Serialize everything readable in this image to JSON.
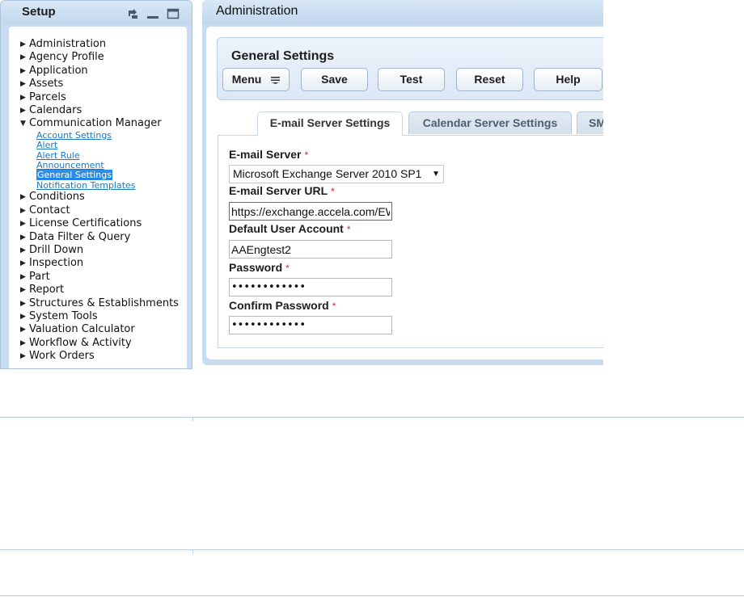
{
  "setup": {
    "title": "Setup",
    "tree": [
      {
        "label": "Administration",
        "expanded": false
      },
      {
        "label": "Agency Profile",
        "expanded": false
      },
      {
        "label": "Application",
        "expanded": false
      },
      {
        "label": "Assets",
        "expanded": false
      },
      {
        "label": "Parcels",
        "expanded": false
      },
      {
        "label": "Calendars",
        "expanded": false
      },
      {
        "label": "Communication Manager",
        "expanded": true,
        "children": [
          {
            "label": "Account Settings"
          },
          {
            "label": "Alert"
          },
          {
            "label": "Alert Rule"
          },
          {
            "label": "Announcement"
          },
          {
            "label": "General Settings",
            "selected": true
          },
          {
            "label": "Notification Templates"
          }
        ]
      },
      {
        "label": "Conditions",
        "expanded": false
      },
      {
        "label": "Contact",
        "expanded": false
      },
      {
        "label": "License Certifications",
        "expanded": false
      },
      {
        "label": "Data Filter & Query",
        "expanded": false
      },
      {
        "label": "Drill Down",
        "expanded": false
      },
      {
        "label": "Inspection",
        "expanded": false
      },
      {
        "label": "Part",
        "expanded": false
      },
      {
        "label": "Report",
        "expanded": false
      },
      {
        "label": "Structures & Establishments",
        "expanded": false
      },
      {
        "label": "System Tools",
        "expanded": false
      },
      {
        "label": "Valuation Calculator",
        "expanded": false
      },
      {
        "label": "Workflow & Activity",
        "expanded": false
      },
      {
        "label": "Work Orders",
        "expanded": false
      }
    ]
  },
  "admin": {
    "title": "Administration",
    "section_title": "General Settings",
    "toolbar": {
      "menu": "Menu",
      "save": "Save",
      "test": "Test",
      "reset": "Reset",
      "help": "Help"
    },
    "tabs": [
      {
        "label": "E-mail Server Settings",
        "active": true
      },
      {
        "label": "Calendar Server Settings",
        "active": false
      },
      {
        "label": "SMS",
        "active": false
      }
    ],
    "form": {
      "required_mark": "*",
      "email_server_label": "E-mail Server",
      "email_server_value": "Microsoft Exchange Server 2010 SP1",
      "email_server_url_label": "E-mail Server URL",
      "email_server_url_value": "https://exchange.accela.com/EWS/Exchange.asmx",
      "default_user_label": "Default User Account",
      "default_user_value": "AAEngtest2",
      "password_label": "Password",
      "password_value": "123456789012",
      "confirm_password_label": "Confirm Password",
      "confirm_password_value": "123456789012"
    }
  },
  "colors": {
    "panel_bg": "#c9dcef",
    "link": "#1c79c4",
    "selected_bg": "#2b8ee8",
    "required": "#d6262b"
  }
}
